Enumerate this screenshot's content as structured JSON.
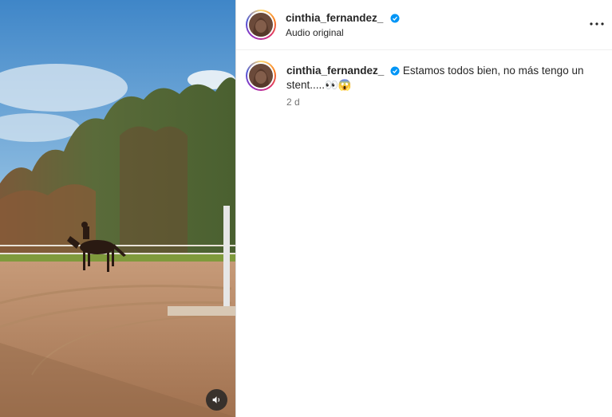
{
  "post": {
    "username": "cinthia_fernandez_",
    "audio_label": "Audio original",
    "more_icon": "more-horizontal-icon",
    "verified_color": "#0095f6"
  },
  "caption": {
    "username": "cinthia_fernandez_",
    "text": "Estamos todos bien, no más tengo un stent.....",
    "emoji": "👀😱",
    "time": "2 d"
  },
  "media": {
    "description_icon": "volume-icon"
  }
}
